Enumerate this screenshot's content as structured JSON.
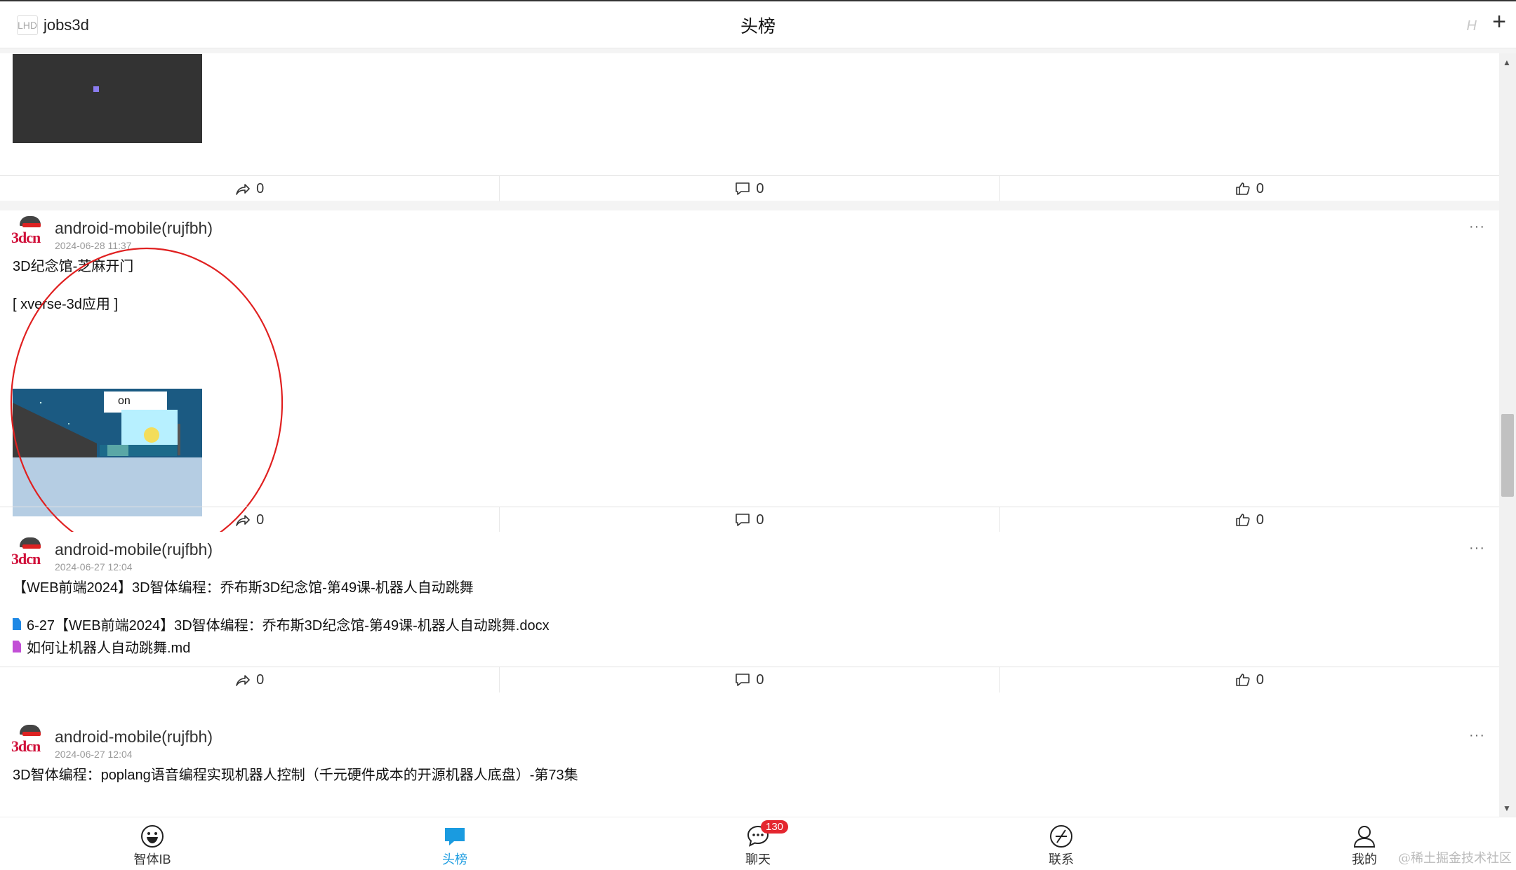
{
  "header": {
    "username": "jobs3d",
    "user_icon": "LHD",
    "title": "头榜",
    "h_icon": "H",
    "plus": "+"
  },
  "posts": [
    {
      "shares": "0",
      "comments": "0",
      "likes": "0"
    },
    {
      "author": "android-mobile(rujfbh)",
      "date": "2024-06-28 11:37",
      "logo": "3dcn",
      "text": "3D纪念馆-芝麻开门",
      "tag": "[ xverse-3d应用 ]",
      "thumb_label": "on",
      "shares": "0",
      "comments": "0",
      "likes": "0"
    },
    {
      "author": "android-mobile(rujfbh)",
      "date": "2024-06-27 12:04",
      "logo": "3dcn",
      "text": "【WEB前端2024】3D智体编程：乔布斯3D纪念馆-第49课-机器人自动跳舞",
      "attachments": [
        {
          "name": "6-27【WEB前端2024】3D智体编程：乔布斯3D纪念馆-第49课-机器人自动跳舞.docx",
          "color": "#1e88e5",
          "icon": "file-icon"
        },
        {
          "name": "如何让机器人自动跳舞.md",
          "color": "#c24fd6",
          "icon": "file-icon"
        }
      ],
      "shares": "0",
      "comments": "0",
      "likes": "0"
    },
    {
      "author": "android-mobile(rujfbh)",
      "date": "2024-06-27 12:04",
      "logo": "3dcn",
      "text": "3D智体编程：poplang语音编程实现机器人控制（千元硬件成本的开源机器人底盘）-第73集"
    }
  ],
  "more_label": "···",
  "tabs": [
    {
      "label": "智体IB",
      "icon": "smiley-icon"
    },
    {
      "label": "头榜",
      "icon": "chat-bubble-icon",
      "active": true
    },
    {
      "label": "聊天",
      "icon": "chat-icon",
      "badge": "130"
    },
    {
      "label": "联系",
      "icon": "compass-icon"
    },
    {
      "label": "我的",
      "icon": "user-icon"
    }
  ],
  "watermark": "@稀土掘金技术社区",
  "colors": {
    "accent": "#1a9be0",
    "badge": "#e4262f",
    "annotation": "#e02020"
  }
}
